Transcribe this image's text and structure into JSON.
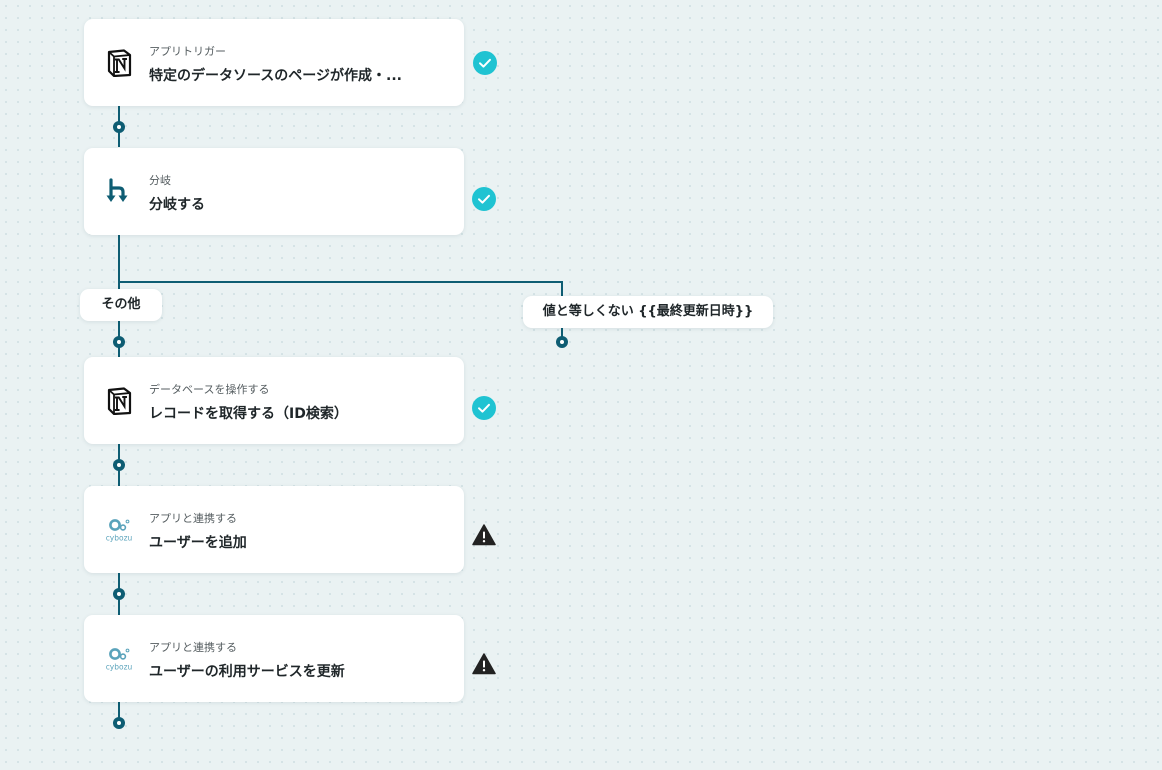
{
  "steps": [
    {
      "subtitle": "アプリトリガー",
      "title": "特定のデータソースのページが作成・...",
      "icon": "notion-icon",
      "status": "success"
    },
    {
      "subtitle": "分岐",
      "title": "分岐する",
      "icon": "branch-icon",
      "status": "success"
    },
    {
      "subtitle": "データベースを操作する",
      "title": "レコードを取得する（ID検索）",
      "icon": "notion-icon",
      "status": "success"
    },
    {
      "subtitle": "アプリと連携する",
      "title": "ユーザーを追加",
      "icon": "cybozu-icon",
      "status": "warning"
    },
    {
      "subtitle": "アプリと連携する",
      "title": "ユーザーの利用サービスを更新",
      "icon": "cybozu-icon",
      "status": "warning"
    }
  ],
  "branches": {
    "left_label": "その他",
    "right_label": "値と等しくない {{最終更新日時}}"
  },
  "brand": {
    "cybozu_text": "cybozu"
  },
  "colors": {
    "connector": "#0e5d73",
    "success": "#1fc3d2",
    "warning": "#222222",
    "card": "#ffffff",
    "background": "#eaf2f3"
  }
}
